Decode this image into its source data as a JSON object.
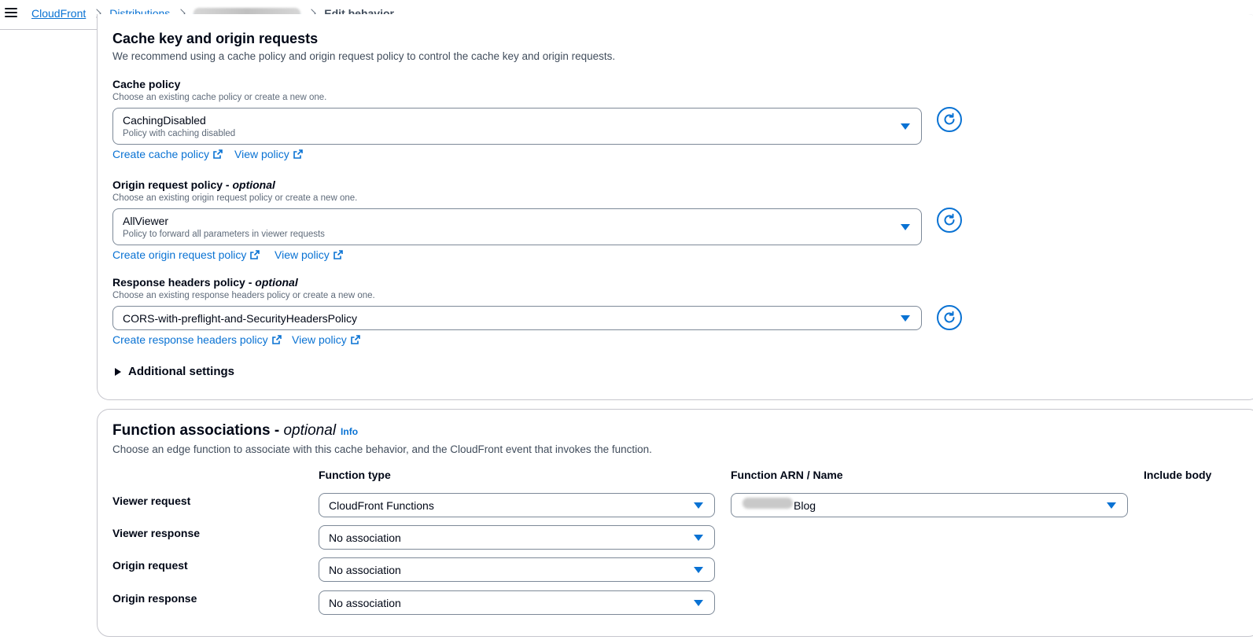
{
  "breadcrumb": {
    "items": [
      "CloudFront",
      "Distributions"
    ],
    "current": "Edit behavior"
  },
  "cache_section": {
    "title": "Cache key and origin requests",
    "description": "We recommend using a cache policy and origin request policy to control the cache key and origin requests.",
    "cache_policy": {
      "label": "Cache policy",
      "hint": "Choose an existing cache policy or create a new one.",
      "value": "CachingDisabled",
      "subtext": "Policy with caching disabled",
      "create_link": "Create cache policy",
      "view_link": "View policy"
    },
    "origin_request_policy": {
      "label": "Origin request policy - ",
      "label_optional": "optional",
      "hint": "Choose an existing origin request policy or create a new one.",
      "value": "AllViewer",
      "subtext": "Policy to forward all parameters in viewer requests",
      "create_link": "Create origin request policy",
      "view_link": "View policy"
    },
    "response_headers_policy": {
      "label": "Response headers policy - ",
      "label_optional": "optional",
      "hint": "Choose an existing response headers policy or create a new one.",
      "value": "CORS-with-preflight-and-SecurityHeadersPolicy",
      "create_link": "Create response headers policy",
      "view_link": "View policy"
    },
    "additional_settings": "Additional settings"
  },
  "function_section": {
    "title": "Function associations - ",
    "title_optional": "optional",
    "info": "Info",
    "description": "Choose an edge function to associate with this cache behavior, and the CloudFront event that invokes the function.",
    "columns": {
      "function_type": "Function type",
      "function_arn": "Function ARN / Name",
      "include_body": "Include body"
    },
    "rows": [
      {
        "label": "Viewer request",
        "type": "CloudFront Functions",
        "arn_suffix": "Blog"
      },
      {
        "label": "Viewer response",
        "type": "No association"
      },
      {
        "label": "Origin request",
        "type": "No association"
      },
      {
        "label": "Origin response",
        "type": "No association"
      }
    ]
  },
  "colors": {
    "link": "#0972d3",
    "text": "#000716",
    "border": "#7d8998"
  }
}
